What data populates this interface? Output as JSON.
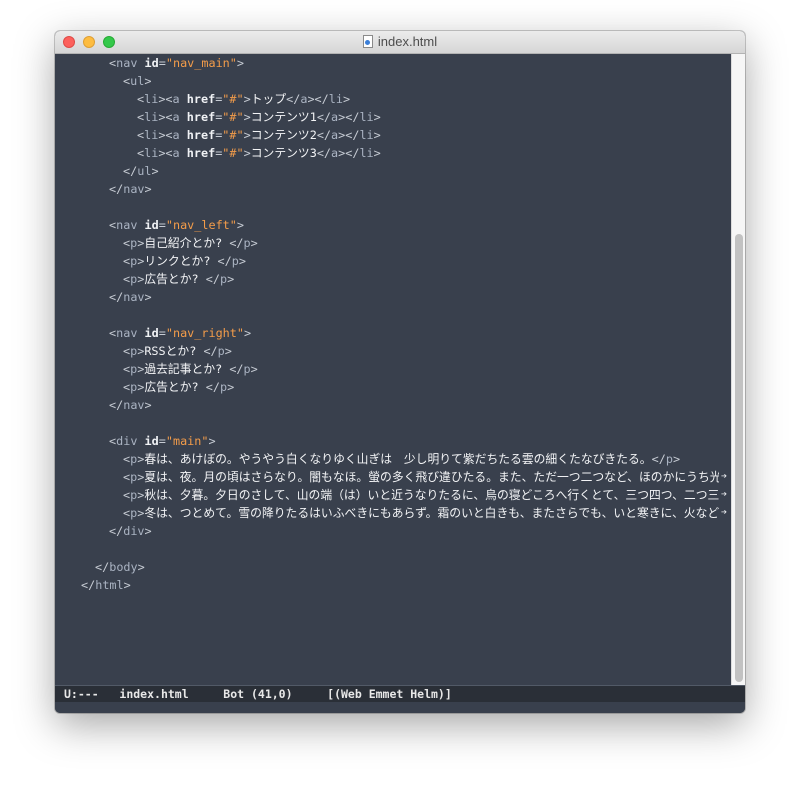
{
  "window": {
    "title": "index.html"
  },
  "editor": {
    "lines": [
      {
        "indent": 6,
        "tokens": [
          [
            "p",
            "<"
          ],
          [
            "tag",
            "nav"
          ],
          [
            "p",
            " "
          ],
          [
            "attr",
            "id"
          ],
          [
            "p",
            "="
          ],
          [
            "str",
            "\"nav_main\""
          ],
          [
            "p",
            ">"
          ]
        ]
      },
      {
        "indent": 8,
        "tokens": [
          [
            "p",
            "<"
          ],
          [
            "tag",
            "ul"
          ],
          [
            "p",
            ">"
          ]
        ]
      },
      {
        "indent": 10,
        "tokens": [
          [
            "p",
            "<"
          ],
          [
            "tag",
            "li"
          ],
          [
            "p",
            "><"
          ],
          [
            "tag",
            "a"
          ],
          [
            "p",
            " "
          ],
          [
            "attr",
            "href"
          ],
          [
            "p",
            "="
          ],
          [
            "str",
            "\"#\""
          ],
          [
            "p",
            ">"
          ],
          [
            "t",
            "トップ"
          ],
          [
            "p",
            "</"
          ],
          [
            "tag",
            "a"
          ],
          [
            "p",
            "></"
          ],
          [
            "tag",
            "li"
          ],
          [
            "p",
            ">"
          ]
        ]
      },
      {
        "indent": 10,
        "tokens": [
          [
            "p",
            "<"
          ],
          [
            "tag",
            "li"
          ],
          [
            "p",
            "><"
          ],
          [
            "tag",
            "a"
          ],
          [
            "p",
            " "
          ],
          [
            "attr",
            "href"
          ],
          [
            "p",
            "="
          ],
          [
            "str",
            "\"#\""
          ],
          [
            "p",
            ">"
          ],
          [
            "t",
            "コンテンツ1"
          ],
          [
            "p",
            "</"
          ],
          [
            "tag",
            "a"
          ],
          [
            "p",
            "></"
          ],
          [
            "tag",
            "li"
          ],
          [
            "p",
            ">"
          ]
        ]
      },
      {
        "indent": 10,
        "tokens": [
          [
            "p",
            "<"
          ],
          [
            "tag",
            "li"
          ],
          [
            "p",
            "><"
          ],
          [
            "tag",
            "a"
          ],
          [
            "p",
            " "
          ],
          [
            "attr",
            "href"
          ],
          [
            "p",
            "="
          ],
          [
            "str",
            "\"#\""
          ],
          [
            "p",
            ">"
          ],
          [
            "t",
            "コンテンツ2"
          ],
          [
            "p",
            "</"
          ],
          [
            "tag",
            "a"
          ],
          [
            "p",
            "></"
          ],
          [
            "tag",
            "li"
          ],
          [
            "p",
            ">"
          ]
        ]
      },
      {
        "indent": 10,
        "tokens": [
          [
            "p",
            "<"
          ],
          [
            "tag",
            "li"
          ],
          [
            "p",
            "><"
          ],
          [
            "tag",
            "a"
          ],
          [
            "p",
            " "
          ],
          [
            "attr",
            "href"
          ],
          [
            "p",
            "="
          ],
          [
            "str",
            "\"#\""
          ],
          [
            "p",
            ">"
          ],
          [
            "t",
            "コンテンツ3"
          ],
          [
            "p",
            "</"
          ],
          [
            "tag",
            "a"
          ],
          [
            "p",
            "></"
          ],
          [
            "tag",
            "li"
          ],
          [
            "p",
            ">"
          ]
        ]
      },
      {
        "indent": 8,
        "tokens": [
          [
            "p",
            "</"
          ],
          [
            "tag",
            "ul"
          ],
          [
            "p",
            ">"
          ]
        ]
      },
      {
        "indent": 6,
        "tokens": [
          [
            "p",
            "</"
          ],
          [
            "tag",
            "nav"
          ],
          [
            "p",
            ">"
          ]
        ]
      },
      {
        "indent": 0,
        "tokens": []
      },
      {
        "indent": 6,
        "tokens": [
          [
            "p",
            "<"
          ],
          [
            "tag",
            "nav"
          ],
          [
            "p",
            " "
          ],
          [
            "attr",
            "id"
          ],
          [
            "p",
            "="
          ],
          [
            "str",
            "\"nav_left\""
          ],
          [
            "p",
            ">"
          ]
        ]
      },
      {
        "indent": 8,
        "tokens": [
          [
            "p",
            "<"
          ],
          [
            "tag",
            "p"
          ],
          [
            "p",
            ">"
          ],
          [
            "t",
            "自己紹介とか? "
          ],
          [
            "p",
            "</"
          ],
          [
            "tag",
            "p"
          ],
          [
            "p",
            ">"
          ]
        ]
      },
      {
        "indent": 8,
        "tokens": [
          [
            "p",
            "<"
          ],
          [
            "tag",
            "p"
          ],
          [
            "p",
            ">"
          ],
          [
            "t",
            "リンクとか? "
          ],
          [
            "p",
            "</"
          ],
          [
            "tag",
            "p"
          ],
          [
            "p",
            ">"
          ]
        ]
      },
      {
        "indent": 8,
        "tokens": [
          [
            "p",
            "<"
          ],
          [
            "tag",
            "p"
          ],
          [
            "p",
            ">"
          ],
          [
            "t",
            "広告とか? "
          ],
          [
            "p",
            "</"
          ],
          [
            "tag",
            "p"
          ],
          [
            "p",
            ">"
          ]
        ]
      },
      {
        "indent": 6,
        "tokens": [
          [
            "p",
            "</"
          ],
          [
            "tag",
            "nav"
          ],
          [
            "p",
            ">"
          ]
        ]
      },
      {
        "indent": 0,
        "tokens": []
      },
      {
        "indent": 6,
        "tokens": [
          [
            "p",
            "<"
          ],
          [
            "tag",
            "nav"
          ],
          [
            "p",
            " "
          ],
          [
            "attr",
            "id"
          ],
          [
            "p",
            "="
          ],
          [
            "str",
            "\"nav_right\""
          ],
          [
            "p",
            ">"
          ]
        ]
      },
      {
        "indent": 8,
        "tokens": [
          [
            "p",
            "<"
          ],
          [
            "tag",
            "p"
          ],
          [
            "p",
            ">"
          ],
          [
            "t",
            "RSSとか? "
          ],
          [
            "p",
            "</"
          ],
          [
            "tag",
            "p"
          ],
          [
            "p",
            ">"
          ]
        ]
      },
      {
        "indent": 8,
        "tokens": [
          [
            "p",
            "<"
          ],
          [
            "tag",
            "p"
          ],
          [
            "p",
            ">"
          ],
          [
            "t",
            "過去記事とか? "
          ],
          [
            "p",
            "</"
          ],
          [
            "tag",
            "p"
          ],
          [
            "p",
            ">"
          ]
        ]
      },
      {
        "indent": 8,
        "tokens": [
          [
            "p",
            "<"
          ],
          [
            "tag",
            "p"
          ],
          [
            "p",
            ">"
          ],
          [
            "t",
            "広告とか? "
          ],
          [
            "p",
            "</"
          ],
          [
            "tag",
            "p"
          ],
          [
            "p",
            ">"
          ]
        ]
      },
      {
        "indent": 6,
        "tokens": [
          [
            "p",
            "</"
          ],
          [
            "tag",
            "nav"
          ],
          [
            "p",
            ">"
          ]
        ]
      },
      {
        "indent": 0,
        "tokens": []
      },
      {
        "indent": 6,
        "tokens": [
          [
            "p",
            "<"
          ],
          [
            "tag",
            "div"
          ],
          [
            "p",
            " "
          ],
          [
            "attr",
            "id"
          ],
          [
            "p",
            "="
          ],
          [
            "str",
            "\"main\""
          ],
          [
            "p",
            ">"
          ]
        ]
      },
      {
        "indent": 8,
        "tokens": [
          [
            "p",
            "<"
          ],
          [
            "tag",
            "p"
          ],
          [
            "p",
            ">"
          ],
          [
            "t",
            "春は、あけぼの。やうやう白くなりゆく山ぎは　少し明りて紫だちたる雲の細くたなびきたる。"
          ],
          [
            "p",
            "</"
          ],
          [
            "tag",
            "p"
          ],
          [
            "p",
            ">"
          ]
        ]
      },
      {
        "indent": 8,
        "truncated": true,
        "tokens": [
          [
            "p",
            "<"
          ],
          [
            "tag",
            "p"
          ],
          [
            "p",
            ">"
          ],
          [
            "t",
            "夏は、夜。月の頃はさらなり。闇もなほ。螢の多く飛び違ひたる。また、ただ一つ二つなど、ほのかにうち光りて"
          ]
        ]
      },
      {
        "indent": 8,
        "truncated": true,
        "tokens": [
          [
            "p",
            "<"
          ],
          [
            "tag",
            "p"
          ],
          [
            "p",
            ">"
          ],
          [
            "t",
            "秋は、夕暮。夕日のさして、山の端（は）いと近うなりたるに、烏の寝どころへ行くとて、三つ四つ、二つ三つな"
          ]
        ]
      },
      {
        "indent": 8,
        "truncated": true,
        "tokens": [
          [
            "p",
            "<"
          ],
          [
            "tag",
            "p"
          ],
          [
            "p",
            ">"
          ],
          [
            "t",
            "冬は、つとめて。雪の降りたるはいふべきにもあらず。霜のいと白きも、またさらでも、いと寒きに、火など急ぎ"
          ]
        ]
      },
      {
        "indent": 6,
        "tokens": [
          [
            "p",
            "</"
          ],
          [
            "tag",
            "div"
          ],
          [
            "p",
            ">"
          ]
        ]
      },
      {
        "indent": 0,
        "tokens": []
      },
      {
        "indent": 4,
        "tokens": [
          [
            "p",
            "</"
          ],
          [
            "tag",
            "body"
          ],
          [
            "p",
            ">"
          ]
        ]
      },
      {
        "indent": 2,
        "tokens": [
          [
            "p",
            "</"
          ],
          [
            "tag",
            "html"
          ],
          [
            "p",
            ">"
          ]
        ]
      }
    ],
    "truncation_marker": "➔"
  },
  "modeline": {
    "status": "U:---",
    "buffer_name": "index.html",
    "position": "Bot (41,0)",
    "modes": "[(Web Emmet Helm)]"
  },
  "colors": {
    "background": "#39404d",
    "string": "#f39c4a",
    "attribute": "#f0f2f5",
    "tag": "#aab3c2",
    "text": "#f3f4f6",
    "modeline_bg": "#2a2f37"
  }
}
